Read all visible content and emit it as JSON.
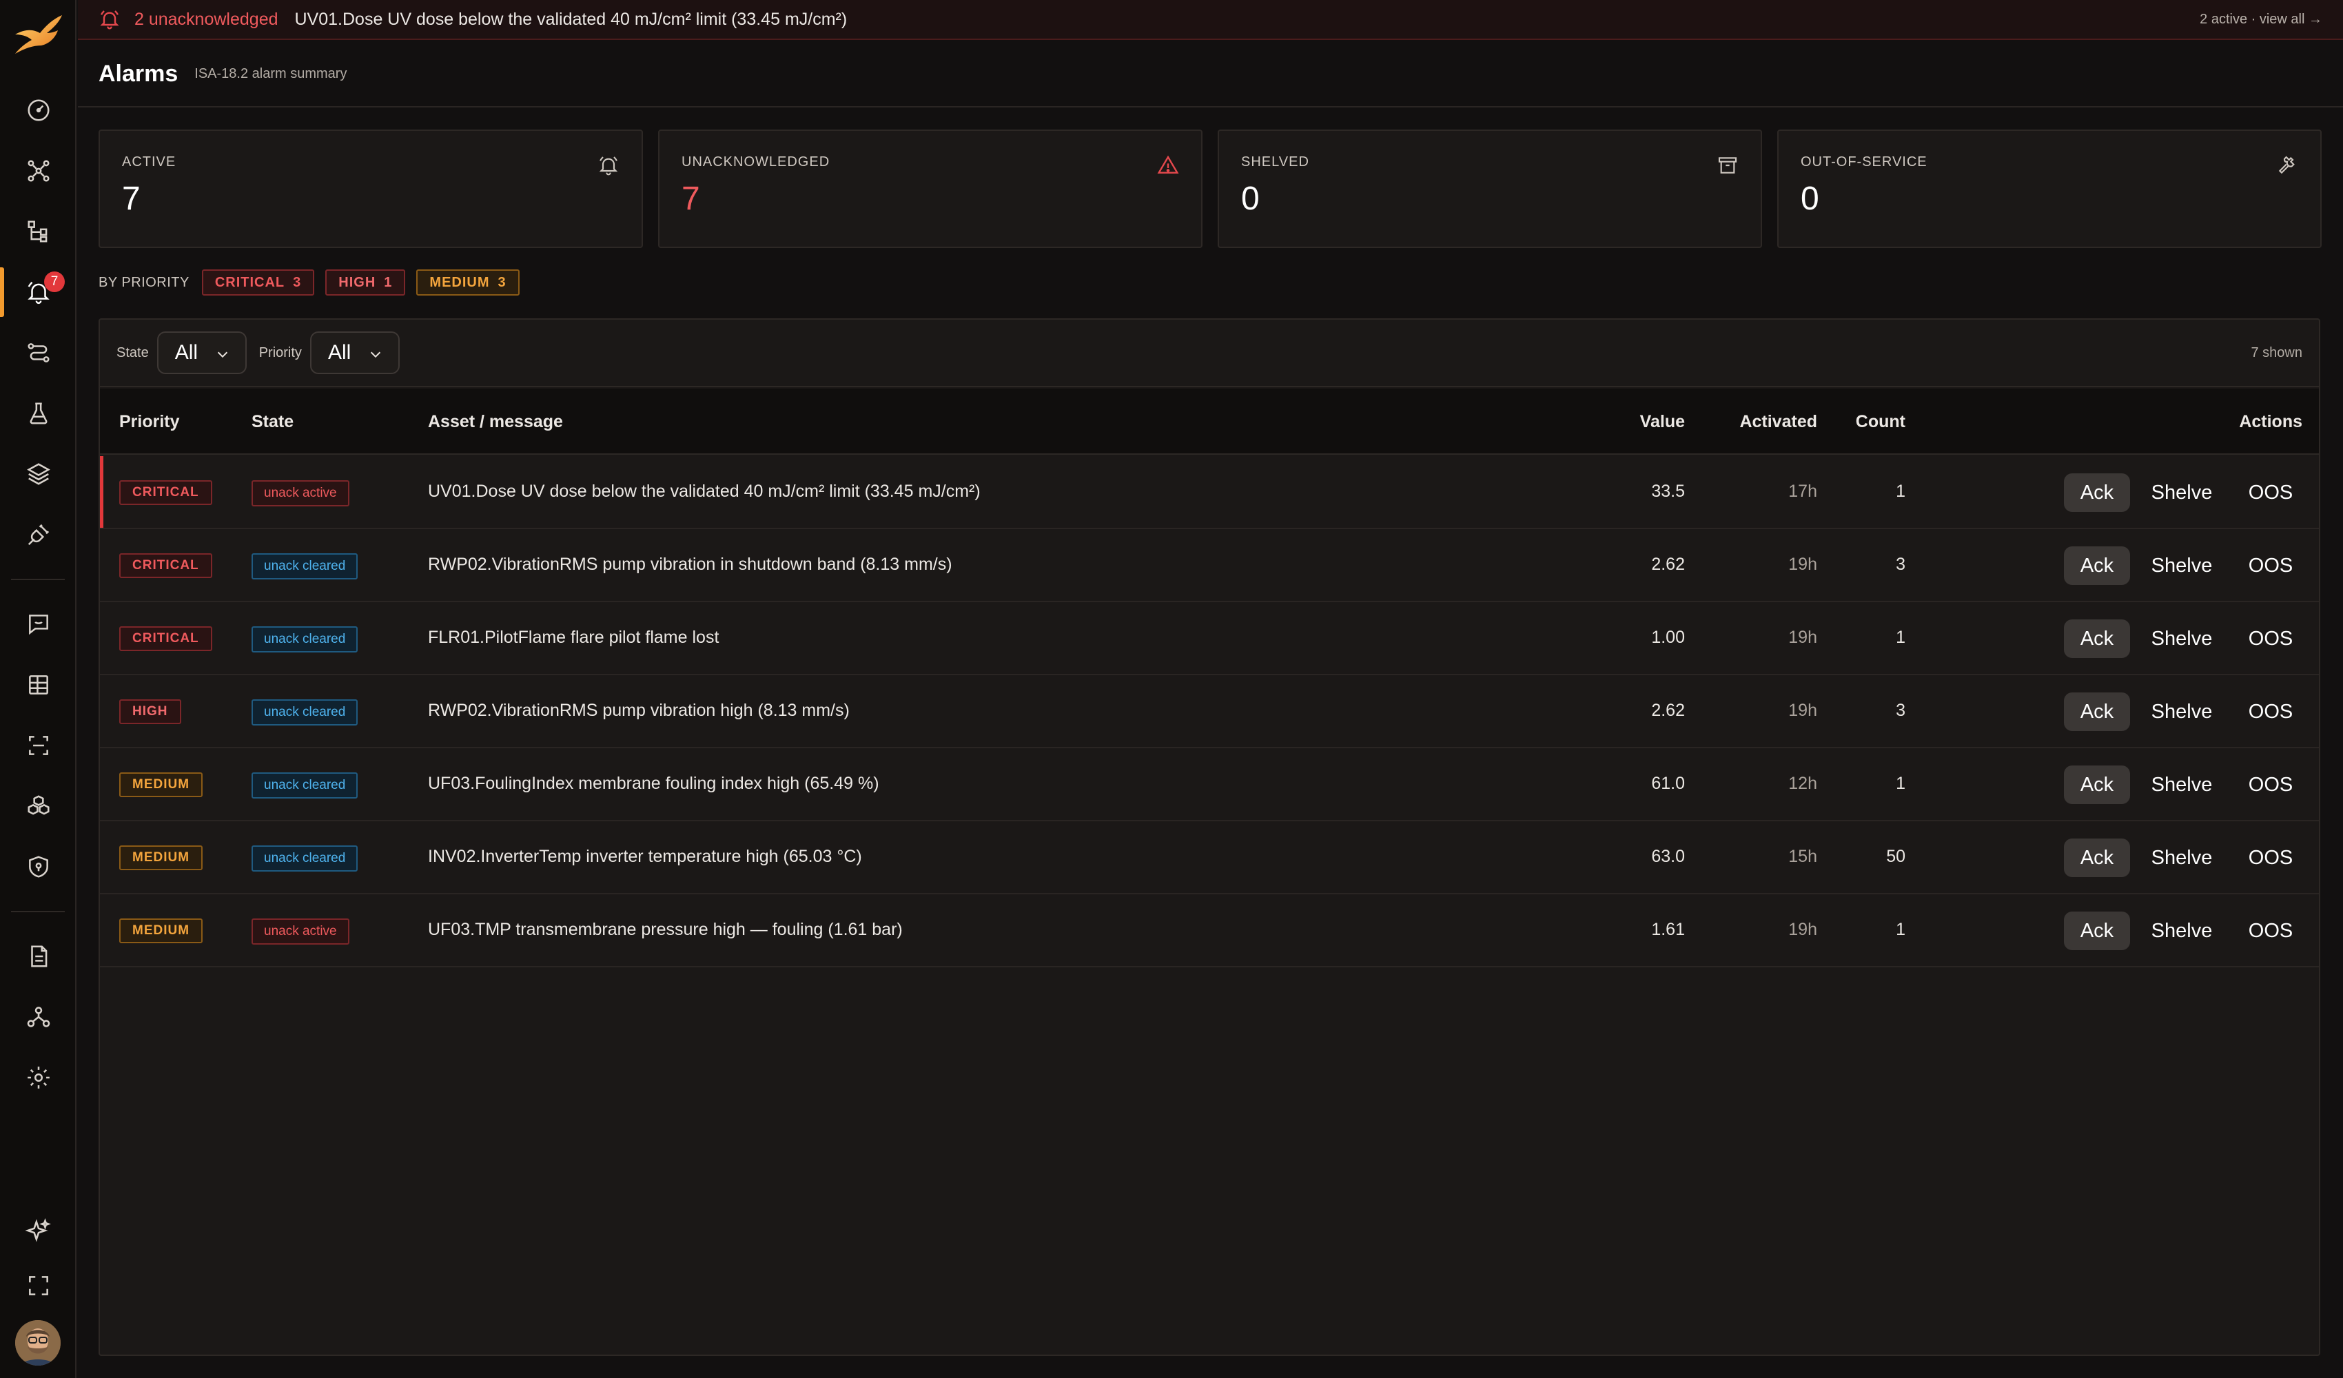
{
  "colors": {
    "accent": "#f29a2e",
    "critical": "#ef5a5d",
    "medium": "#f4a53d",
    "cleared": "#4fb3ee"
  },
  "sidebar": {
    "items": [
      {
        "icon": "gauge-icon",
        "name": "nav-dashboard"
      },
      {
        "icon": "network-nodes-icon",
        "name": "nav-topology"
      },
      {
        "icon": "hierarchy-icon",
        "name": "nav-hierarchy"
      },
      {
        "icon": "bell-icon",
        "name": "nav-alarms",
        "badge": "7",
        "active": true
      },
      {
        "icon": "route-icon",
        "name": "nav-routes"
      },
      {
        "icon": "flask-icon",
        "name": "nav-lab"
      },
      {
        "icon": "layers-icon",
        "name": "nav-layers"
      },
      {
        "icon": "plug-icon",
        "name": "nav-connections"
      },
      {
        "icon": "chat-icon",
        "name": "nav-chat"
      },
      {
        "icon": "grid-icon",
        "name": "nav-grid"
      },
      {
        "icon": "scan-icon",
        "name": "nav-scan"
      },
      {
        "icon": "cubes-icon",
        "name": "nav-models"
      },
      {
        "icon": "shield-icon",
        "name": "nav-security"
      },
      {
        "icon": "document-icon",
        "name": "nav-reports"
      },
      {
        "icon": "users-icon",
        "name": "nav-users"
      },
      {
        "icon": "gear-icon",
        "name": "nav-settings"
      },
      {
        "icon": "sparkle-icon",
        "name": "nav-assistant"
      },
      {
        "icon": "fullscreen-icon",
        "name": "nav-fullscreen"
      }
    ]
  },
  "banner": {
    "count": "2 unacknowledged",
    "message": "UV01.Dose UV dose below the validated 40 mJ/cm² limit (33.45 mJ/cm²)",
    "right": "2 active · view all →"
  },
  "header": {
    "title": "Alarms",
    "subtitle": "ISA-18.2 alarm summary"
  },
  "kpis": [
    {
      "label": "ACTIVE",
      "value": "7",
      "icon": "bell-icon"
    },
    {
      "label": "UNACKNOWLEDGED",
      "value": "7",
      "icon": "warning-icon"
    },
    {
      "label": "SHELVED",
      "value": "0",
      "icon": "archive-icon"
    },
    {
      "label": "OUT-OF-SERVICE",
      "value": "0",
      "icon": "wrench-icon"
    }
  ],
  "priority_summary": {
    "label": "BY PRIORITY",
    "chips": [
      {
        "label": "CRITICAL",
        "count": "3"
      },
      {
        "label": "HIGH",
        "count": "1"
      },
      {
        "label": "MEDIUM",
        "count": "3"
      }
    ]
  },
  "filters": {
    "state_label": "State",
    "state_value": "All",
    "priority_label": "Priority",
    "priority_value": "All",
    "shown": "7 shown"
  },
  "table": {
    "columns": {
      "priority": "Priority",
      "state": "State",
      "asset": "Asset / message",
      "value": "Value",
      "activated": "Activated",
      "count": "Count",
      "actions": "Actions"
    },
    "rows": [
      {
        "priority": "CRITICAL",
        "state": "unack active",
        "message": "UV01.Dose UV dose below the validated 40 mJ/cm² limit (33.45 mJ/cm²)",
        "value": "33.5",
        "activated": "17h",
        "count": "1"
      },
      {
        "priority": "CRITICAL",
        "state": "unack cleared",
        "message": "RWP02.VibrationRMS pump vibration in shutdown band (8.13 mm/s)",
        "value": "2.62",
        "activated": "19h",
        "count": "3"
      },
      {
        "priority": "CRITICAL",
        "state": "unack cleared",
        "message": "FLR01.PilotFlame flare pilot flame lost",
        "value": "1.00",
        "activated": "19h",
        "count": "1"
      },
      {
        "priority": "HIGH",
        "state": "unack cleared",
        "message": "RWP02.VibrationRMS pump vibration high (8.13 mm/s)",
        "value": "2.62",
        "activated": "19h",
        "count": "3"
      },
      {
        "priority": "MEDIUM",
        "state": "unack cleared",
        "message": "UF03.FoulingIndex membrane fouling index high (65.49 %)",
        "value": "61.0",
        "activated": "12h",
        "count": "1"
      },
      {
        "priority": "MEDIUM",
        "state": "unack cleared",
        "message": "INV02.InverterTemp inverter temperature high (65.03 °C)",
        "value": "63.0",
        "activated": "15h",
        "count": "50"
      },
      {
        "priority": "MEDIUM",
        "state": "unack active",
        "message": "UF03.TMP transmembrane pressure high — fouling (1.61 bar)",
        "value": "1.61",
        "activated": "19h",
        "count": "1"
      }
    ],
    "actions": {
      "ack": "Ack",
      "shelve": "Shelve",
      "oos": "OOS"
    }
  }
}
